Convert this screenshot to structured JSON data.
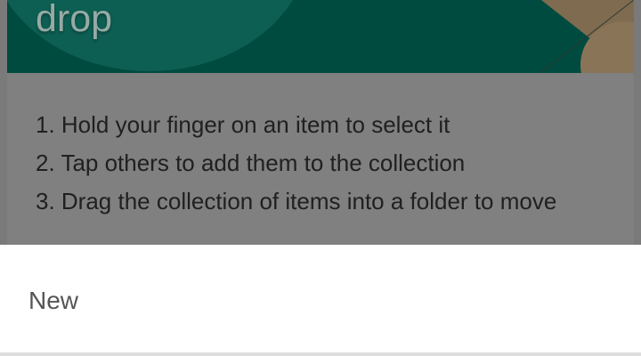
{
  "tutorial_card": {
    "title": "drop",
    "steps": [
      "1. Hold your finger on an item to select it",
      "2. Tap others to add them to the collection",
      "3. Drag the collection of items into a folder to move"
    ]
  },
  "bottom_sheet": {
    "new_label": "New"
  }
}
